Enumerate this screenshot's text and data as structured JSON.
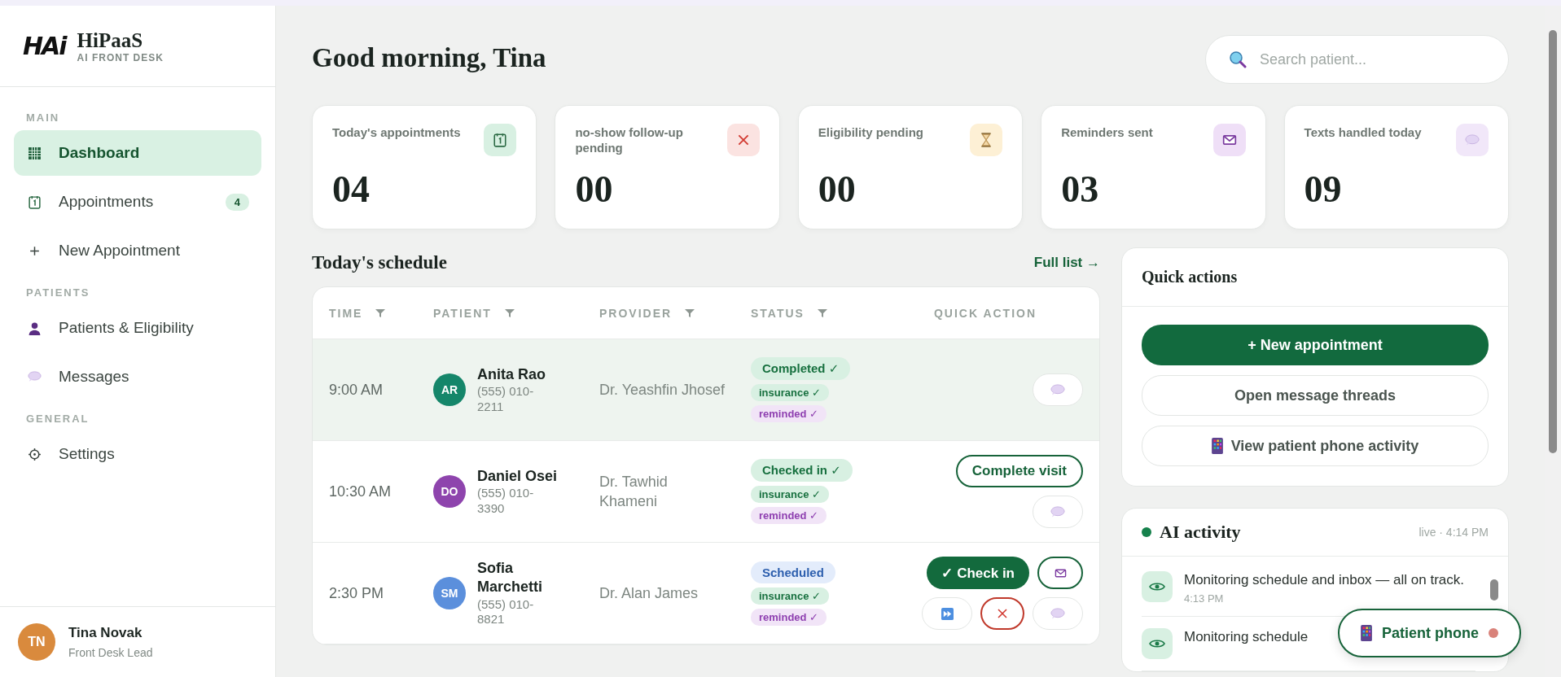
{
  "brand": {
    "logo": "HAi",
    "name": "HiPaaS",
    "tagline": "AI FRONT DESK"
  },
  "nav_sections": [
    {
      "title": "MAIN",
      "items": [
        {
          "label": "Dashboard",
          "kind": "grid",
          "selected": true
        },
        {
          "label": "Appointments",
          "kind": "calendar",
          "selected": false,
          "badge": "4"
        },
        {
          "label": "New Appointment",
          "kind": "plus",
          "selected": false
        }
      ]
    },
    {
      "title": "PATIENTS",
      "items": [
        {
          "label": "Patients & Eligibility",
          "kind": "person",
          "selected": false
        },
        {
          "label": "Messages",
          "kind": "chat",
          "selected": false
        }
      ]
    },
    {
      "title": "GENERAL",
      "items": [
        {
          "label": "Settings",
          "kind": "gear",
          "selected": false
        }
      ]
    }
  ],
  "user": {
    "initials": "TN",
    "name": "Tina Novak",
    "role": "Front Desk Lead"
  },
  "greeting": "Good morning, Tina",
  "search": {
    "placeholder": "Search patient..."
  },
  "stats": [
    {
      "label": "Today's appointments",
      "value": "04",
      "kind": "calendar"
    },
    {
      "label": "no-show follow-up pending",
      "value": "00",
      "kind": "cross"
    },
    {
      "label": "Eligibility pending",
      "value": "00",
      "kind": "hourglass"
    },
    {
      "label": "Reminders sent",
      "value": "03",
      "kind": "mail"
    },
    {
      "label": "Texts handled today",
      "value": "09",
      "kind": "chat"
    }
  ],
  "schedule": {
    "title": "Today's schedule",
    "link": "Full list →",
    "columns": [
      {
        "label": "TIME",
        "filter": true
      },
      {
        "label": "PATIENT",
        "filter": true
      },
      {
        "label": "PROVIDER",
        "filter": true
      },
      {
        "label": "STATUS",
        "filter": true
      },
      {
        "label": "QUICK ACTION",
        "filter": false
      }
    ],
    "rows": [
      {
        "time": "9:00 AM",
        "initials": "AR",
        "color": "#15866a",
        "name": "Anita Rao",
        "phone": "(555) 010-2211",
        "provider": "Dr. Yeashfin Jhosef",
        "highlighted": true,
        "status": {
          "label": "Completed ✓",
          "kind": "done"
        },
        "tags": [
          {
            "label": "insurance ✓",
            "kind": "insurance"
          },
          {
            "label": "reminded ✓",
            "kind": "reminded"
          }
        ],
        "actions": [
          [
            {
              "kind": "chat"
            }
          ]
        ]
      },
      {
        "time": "10:30 AM",
        "initials": "DO",
        "color": "#8e44ad",
        "name": "Daniel Osei",
        "phone": "(555) 010-3390",
        "provider": "Dr. Tawhid Khameni",
        "highlighted": false,
        "status": {
          "label": "Checked in ✓",
          "kind": "done"
        },
        "tags": [
          {
            "label": "insurance ✓",
            "kind": "insurance"
          },
          {
            "label": "reminded ✓",
            "kind": "reminded"
          }
        ],
        "actions": [
          [
            {
              "kind": "outline",
              "label": "Complete visit"
            }
          ],
          [
            {
              "kind": "chat"
            }
          ]
        ]
      },
      {
        "time": "2:30 PM",
        "initials": "SM",
        "color": "#5b8fdc",
        "name": "Sofia Marchetti",
        "phone": "(555) 010-8821",
        "provider": "Dr. Alan James",
        "highlighted": false,
        "status": {
          "label": "Scheduled",
          "kind": "scheduled"
        },
        "tags": [
          {
            "label": "insurance ✓",
            "kind": "insurance"
          },
          {
            "label": "reminded ✓",
            "kind": "reminded"
          }
        ],
        "actions": [
          [
            {
              "kind": "primary",
              "label": "✓ Check in"
            },
            {
              "kind": "mail"
            }
          ],
          [
            {
              "kind": "skip"
            },
            {
              "kind": "cancel"
            },
            {
              "kind": "chat"
            }
          ]
        ]
      }
    ]
  },
  "quick_actions": {
    "title": "Quick actions",
    "buttons": [
      {
        "label": "+ New appointment",
        "kind": "primary"
      },
      {
        "label": "Open message threads",
        "kind": "plain"
      },
      {
        "label": "View patient phone activity",
        "kind": "phone"
      }
    ]
  },
  "ai_activity": {
    "title": "AI activity",
    "live": "live · 4:14 PM",
    "items": [
      {
        "text": "Monitoring schedule and inbox — all on track.",
        "time": "4:13 PM"
      },
      {
        "text": "Monitoring schedule"
      }
    ]
  },
  "patient_phone": {
    "label": "Patient phone",
    "online": false
  }
}
